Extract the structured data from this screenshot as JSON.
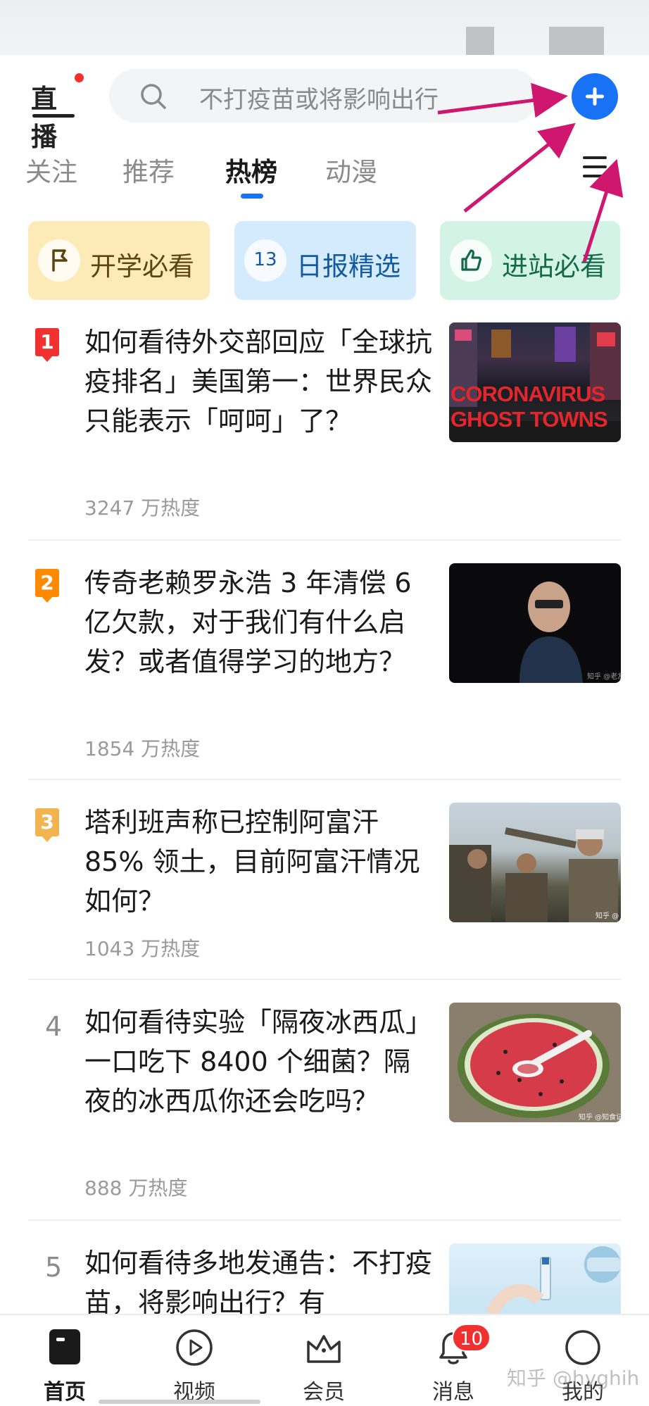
{
  "colors": {
    "brand_blue": "#1772f6",
    "red_dot": "#f0312f",
    "rank1": "#f0312f",
    "rank2": "#ff8a00",
    "rank3": "#f2b451",
    "annotation_arrow": "#d0176f"
  },
  "header": {
    "live_label": "直播",
    "search_placeholder": "不打疫苗或将影响出行",
    "plus_icon": "plus-circle-icon"
  },
  "tabs": [
    {
      "label": "关注",
      "active": false
    },
    {
      "label": "推荐",
      "active": false
    },
    {
      "label": "热榜",
      "active": true
    },
    {
      "label": "动漫",
      "active": false
    }
  ],
  "quick_cards": [
    {
      "label": "开学必看",
      "icon": "flag-icon"
    },
    {
      "label": "日报精选",
      "icon_text": "13",
      "icon": "daily-calendar-icon"
    },
    {
      "label": "进站必看",
      "icon": "thumbs-up-icon"
    }
  ],
  "hot_list": [
    {
      "rank": "1",
      "title": "如何看待外交部回应「全球抗疫排名」美国第一：世界民众只能表示「呵呵」了？",
      "heat": "3247 万热度",
      "thumb_text_1": "CORONAVIRUS",
      "thumb_text_2": "GHOST TOWNS"
    },
    {
      "rank": "2",
      "title": "传奇老赖罗永浩 3 年清偿 6 亿欠款，对于我们有什么启发？或者值得学习的地方？",
      "heat": "1854 万热度",
      "thumb_caption": "知乎 @老友"
    },
    {
      "rank": "3",
      "title": "塔利班声称已控制阿富汗 85% 领土，目前阿富汗情况如何？",
      "heat": "1043 万热度",
      "thumb_caption": "知乎 @"
    },
    {
      "rank": "4",
      "title": "如何看待实验「隔夜冰西瓜」一口吃下 8400 个细菌？隔夜的冰西瓜你还会吃吗？",
      "heat": "888 万热度",
      "thumb_caption": "知乎 @知食记"
    },
    {
      "rank": "5",
      "title": "如何看待多地发通告：不打疫苗，将影响出行？有"
    }
  ],
  "bottom_nav": [
    {
      "label": "首页",
      "icon": "home-icon",
      "active": true
    },
    {
      "label": "视频",
      "icon": "play-icon",
      "active": false
    },
    {
      "label": "会员",
      "icon": "crown-icon",
      "active": false
    },
    {
      "label": "消息",
      "icon": "bell-icon",
      "active": false,
      "badge": "10"
    },
    {
      "label": "我的",
      "icon": "profile-icon",
      "active": false
    }
  ],
  "watermark": "知乎 @hyghih"
}
